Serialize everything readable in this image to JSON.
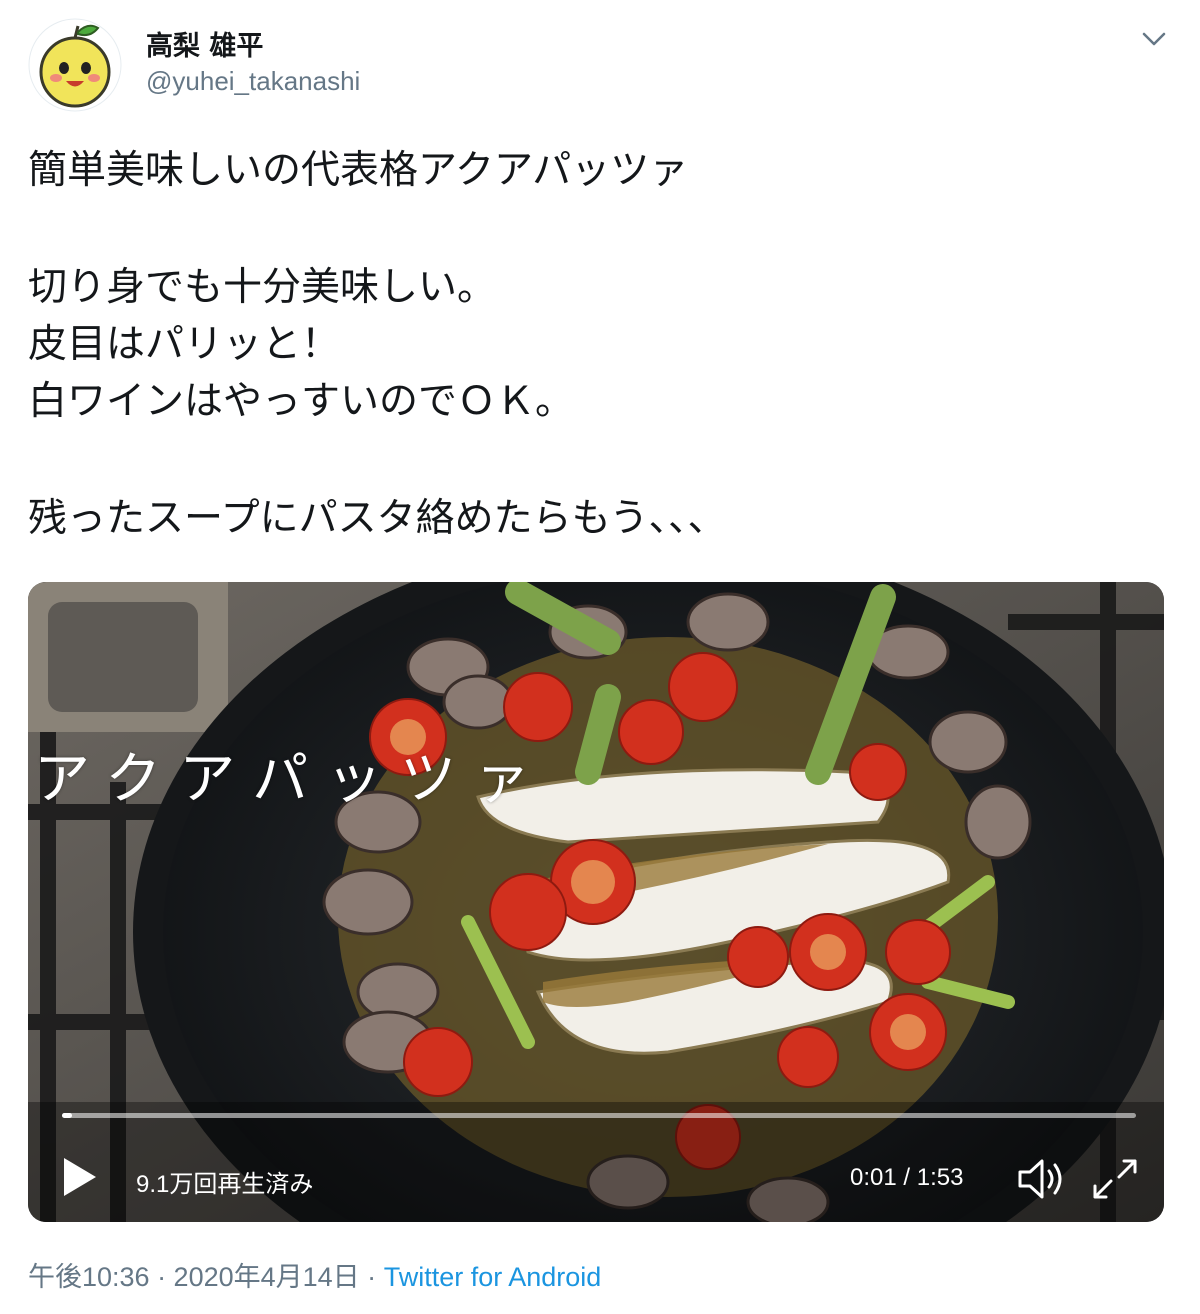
{
  "user": {
    "display_name": "高梨 雄平",
    "handle": "@yuhei_takanashi",
    "avatar_icon": "pear-mascot-avatar-icon"
  },
  "menu_icon": "chevron-down-icon",
  "tweet": {
    "lines": [
      "簡単美味しいの代表格アクアパッツァ",
      "",
      "切り身でも十分美味しい。",
      "皮目はパリッと！",
      "白ワインはやっすいのでＯＫ。",
      "",
      "残ったスープにパスタ絡めたらもう、、、"
    ]
  },
  "video": {
    "overlay_title": "アクアパッツァ",
    "views": "9.1万回再生済み",
    "time": "0:01 / 1:53",
    "progress": 0.009,
    "icons": {
      "play": "play-icon",
      "volume": "volume-icon",
      "fullscreen": "fullscreen-icon"
    }
  },
  "meta": {
    "timestamp": "午後10:36 · 2020年4月14日 ·",
    "source": "Twitter for Android"
  },
  "colors": {
    "text": "#14171a",
    "secondary": "#657786",
    "link": "#1b95e0"
  }
}
